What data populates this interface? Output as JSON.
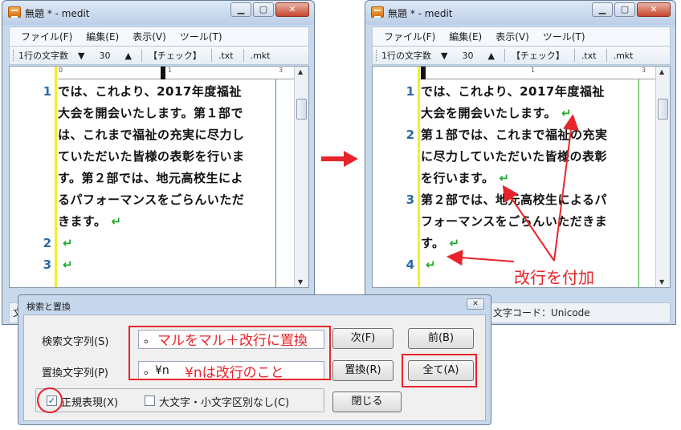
{
  "left_window": {
    "title": "無題 * - medit",
    "menu": [
      "ファイル(F)",
      "編集(E)",
      "表示(V)",
      "ツール(T)"
    ],
    "toolbar": {
      "chars_label": "1行の文字数",
      "chars_value": "30",
      "check": "【チェック】",
      "txt": ".txt",
      "mkt": ".mkt"
    },
    "lines": [
      {
        "num": "1",
        "text": "では、これより、2017年度福祉",
        "ret": ""
      },
      {
        "num": "",
        "text": "大会を開会いたします。第１部で",
        "ret": ""
      },
      {
        "num": "",
        "text": "は、これまで福祉の充実に尽力し",
        "ret": ""
      },
      {
        "num": "",
        "text": "ていただいた皆様の表彰を行いま",
        "ret": ""
      },
      {
        "num": "",
        "text": "す。第２部では、地元高校生によ",
        "ret": ""
      },
      {
        "num": "",
        "text": "るパフォーマンスをごらんいただ",
        "ret": ""
      },
      {
        "num": "",
        "text": "きます。",
        "ret": "↵"
      },
      {
        "num": "2",
        "text": "",
        "ret": "↵"
      },
      {
        "num": "3",
        "text": "",
        "ret": "↵"
      }
    ],
    "status_left": "文"
  },
  "right_window": {
    "title": "無題 * - medit",
    "menu": [
      "ファイル(F)",
      "編集(E)",
      "表示(V)",
      "ツール(T)"
    ],
    "toolbar": {
      "chars_label": "1行の文字数",
      "chars_value": "30",
      "check": "【チェック】",
      "txt": ".txt",
      "mkt": ".mkt"
    },
    "lines": [
      {
        "num": "1",
        "text": "では、これより、2017年度福祉",
        "ret": ""
      },
      {
        "num": "",
        "text": "大会を開会いたします。",
        "ret": "↵"
      },
      {
        "num": "2",
        "text": "第１部では、これまで福祉の充実",
        "ret": ""
      },
      {
        "num": "",
        "text": "に尽力していただいた皆様の表彰",
        "ret": ""
      },
      {
        "num": "",
        "text": "を行います。",
        "ret": "↵"
      },
      {
        "num": "3",
        "text": "第２部では、地元高校生によるパ",
        "ret": ""
      },
      {
        "num": "",
        "text": "フォーマンスをごらんいただきま",
        "ret": ""
      },
      {
        "num": "",
        "text": "す。",
        "ret": "↵"
      },
      {
        "num": "4",
        "text": "",
        "ret": "↵"
      }
    ],
    "status_text": "文字コード：Unicode"
  },
  "dialog": {
    "title": "検索と置換",
    "search_label": "検索文字列(S)",
    "search_value": "。",
    "replace_label": "置換文字列(P)",
    "replace_value": "。¥n",
    "next_button": "次(F)",
    "prev_button": "前(B)",
    "replace_button": "置換(R)",
    "all_button": "全て(A)",
    "regex_label": "正規表現(X)",
    "case_label": "大文字・小文字区別なし(C)",
    "close_button": "閉じる"
  },
  "annotations": {
    "search_note": "マルをマル＋改行に置換",
    "replace_note": "¥nは改行のこと",
    "add_newline_note": "改行を付加"
  },
  "colors": {
    "accent_red": "#e8242a",
    "line_number": "#2a6aa8",
    "return_mark": "#1fa72a"
  }
}
